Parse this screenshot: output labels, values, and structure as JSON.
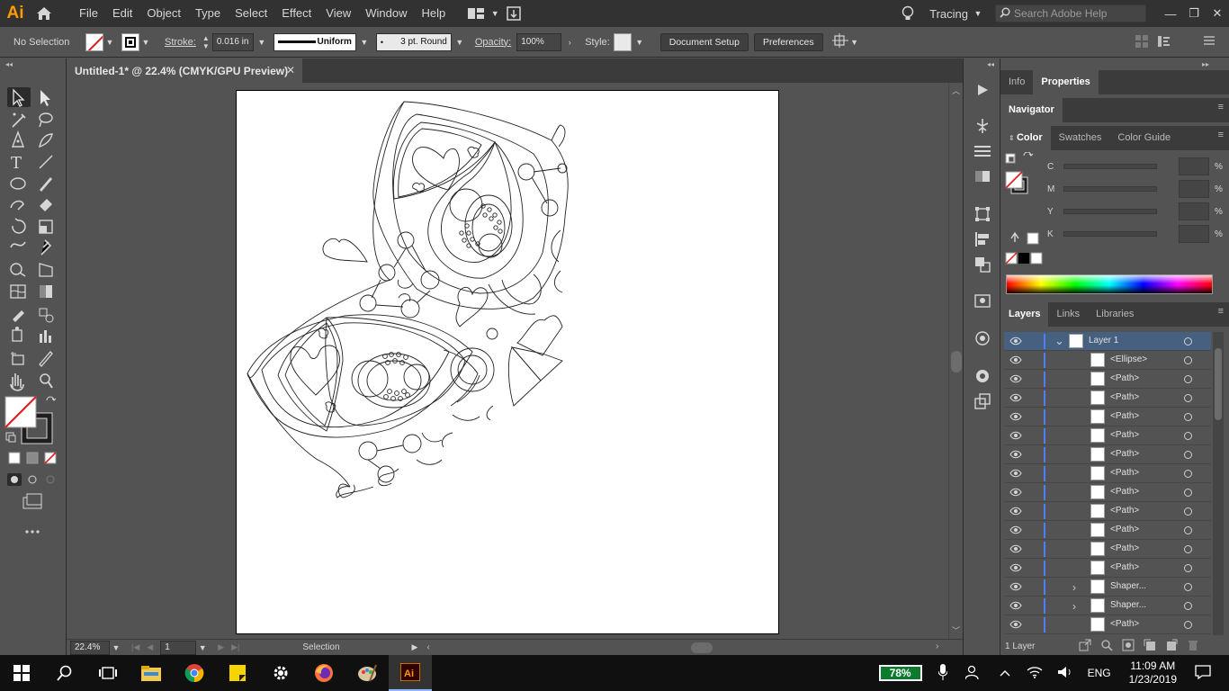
{
  "app": {
    "logo": "Ai"
  },
  "menu": [
    "File",
    "Edit",
    "Object",
    "Type",
    "Select",
    "Effect",
    "View",
    "Window",
    "Help"
  ],
  "header_right": {
    "workspace_label": "Tracing",
    "search_placeholder": "Search Adobe Help",
    "window_buttons": [
      "—",
      "❐",
      "✕"
    ]
  },
  "control_bar": {
    "selection_label": "No Selection",
    "stroke_label": "Stroke:",
    "stroke_value": "0.016 in",
    "stroke_profile": "Uniform",
    "brush": "3 pt. Round",
    "opacity_label": "Opacity:",
    "opacity_value": "100%",
    "style_label": "Style:",
    "document_setup": "Document Setup",
    "preferences": "Preferences"
  },
  "document": {
    "tab_title": "Untitled-1* @ 22.4% (CMYK/GPU Preview)",
    "close": "✕"
  },
  "status_bar": {
    "zoom": "22.4%",
    "artboard": "1",
    "tool": "Selection"
  },
  "right_panel": {
    "top_tabs": [
      "Info",
      "Properties"
    ],
    "navigator": "Navigator",
    "color_tabs": [
      "Color",
      "Swatches",
      "Color Guide"
    ],
    "cmyk": [
      {
        "label": "C",
        "unit": "%"
      },
      {
        "label": "M",
        "unit": "%"
      },
      {
        "label": "Y",
        "unit": "%"
      },
      {
        "label": "K",
        "unit": "%"
      }
    ],
    "layer_tabs": [
      "Layers",
      "Links",
      "Libraries"
    ],
    "layers": [
      {
        "name": "Layer 1",
        "level": 0,
        "expanded": true
      },
      {
        "name": "<Ellipse>",
        "level": 1
      },
      {
        "name": "<Path>",
        "level": 1
      },
      {
        "name": "<Path>",
        "level": 1
      },
      {
        "name": "<Path>",
        "level": 1
      },
      {
        "name": "<Path>",
        "level": 1
      },
      {
        "name": "<Path>",
        "level": 1
      },
      {
        "name": "<Path>",
        "level": 1
      },
      {
        "name": "<Path>",
        "level": 1
      },
      {
        "name": "<Path>",
        "level": 1
      },
      {
        "name": "<Path>",
        "level": 1
      },
      {
        "name": "<Path>",
        "level": 1
      },
      {
        "name": "<Path>",
        "level": 1
      },
      {
        "name": "Shaper...",
        "level": 1,
        "collapsed": true
      },
      {
        "name": "Shaper...",
        "level": 1,
        "collapsed": true
      },
      {
        "name": "<Path>",
        "level": 1
      }
    ],
    "layers_count": "1 Layer"
  },
  "taskbar": {
    "battery": "78%",
    "language": "ENG",
    "time": "11:09 AM",
    "date": "1/23/2019"
  },
  "colors": {
    "accent_orange": "#ff9a00",
    "selection_blue": "#46607f",
    "layer_color": "#4f7ef5"
  }
}
